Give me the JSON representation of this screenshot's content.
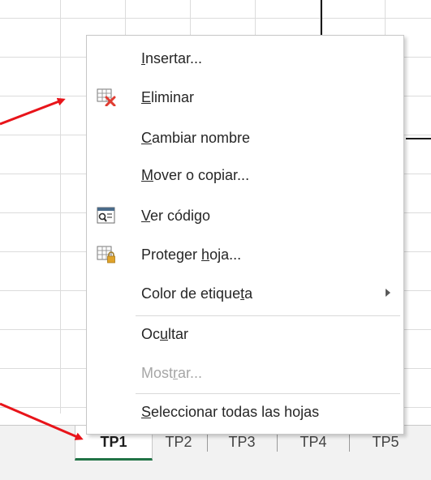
{
  "context_menu": {
    "items": [
      {
        "mnemonic": "I",
        "rest": "nsertar...",
        "enabled": true
      },
      {
        "mnemonic": "E",
        "rest": "liminar",
        "enabled": true,
        "icon": "delete-sheet-icon"
      },
      {
        "mnemonic": "C",
        "rest": "ambiar nombre",
        "enabled": true
      },
      {
        "mnemonic": "M",
        "rest": "over o copiar...",
        "enabled": true
      },
      {
        "mnemonic": "V",
        "rest": "er código",
        "enabled": true,
        "icon": "view-code-icon"
      },
      {
        "before": "Proteger ",
        "mnemonic": "h",
        "rest": "oja...",
        "enabled": true,
        "icon": "protect-sheet-icon"
      },
      {
        "before": "Color de etique",
        "mnemonic": "t",
        "rest": "a",
        "enabled": true,
        "submenu": true
      },
      {
        "before": "Oc",
        "mnemonic": "u",
        "rest": "ltar",
        "enabled": true
      },
      {
        "before": "Most",
        "mnemonic": "r",
        "rest": "ar...",
        "enabled": false
      },
      {
        "mnemonic": "S",
        "rest": "eleccionar todas las hojas",
        "enabled": true
      }
    ]
  },
  "sheet_tabs": {
    "tabs": [
      "TP1",
      "TP2",
      "TP3",
      "TP4",
      "TP5"
    ],
    "active_index": 0
  },
  "colors": {
    "accent_green": "#217346",
    "annotation_arrow": "#e8141a",
    "delete_x": "#e03c31",
    "lock_gold": "#e0a32a"
  },
  "icons": [
    "delete-sheet-icon",
    "view-code-icon",
    "protect-sheet-icon",
    "submenu-arrow-icon",
    "annotation-arrow"
  ]
}
